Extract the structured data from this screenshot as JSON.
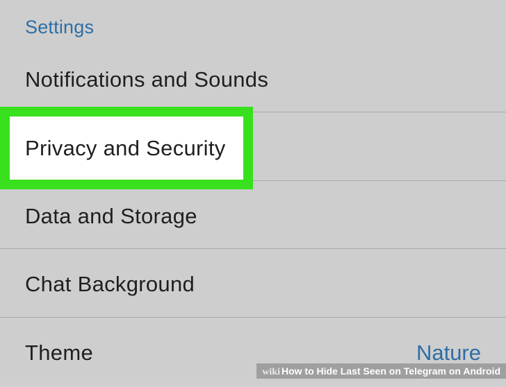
{
  "settings": {
    "header": "Settings",
    "items": [
      {
        "label": "Notifications and Sounds"
      },
      {
        "label": "Privacy and Security"
      },
      {
        "label": "Data and Storage"
      },
      {
        "label": "Chat Background"
      },
      {
        "label": "Theme",
        "value": "Nature"
      }
    ]
  },
  "watermark": {
    "brand": "wiki",
    "how": "How",
    "title": " to Hide Last Seen on Telegram on Android"
  },
  "colors": {
    "background": "#cecece",
    "accent": "#2e6ea6",
    "highlight": "#38e01e",
    "text": "#1f1f1f"
  }
}
